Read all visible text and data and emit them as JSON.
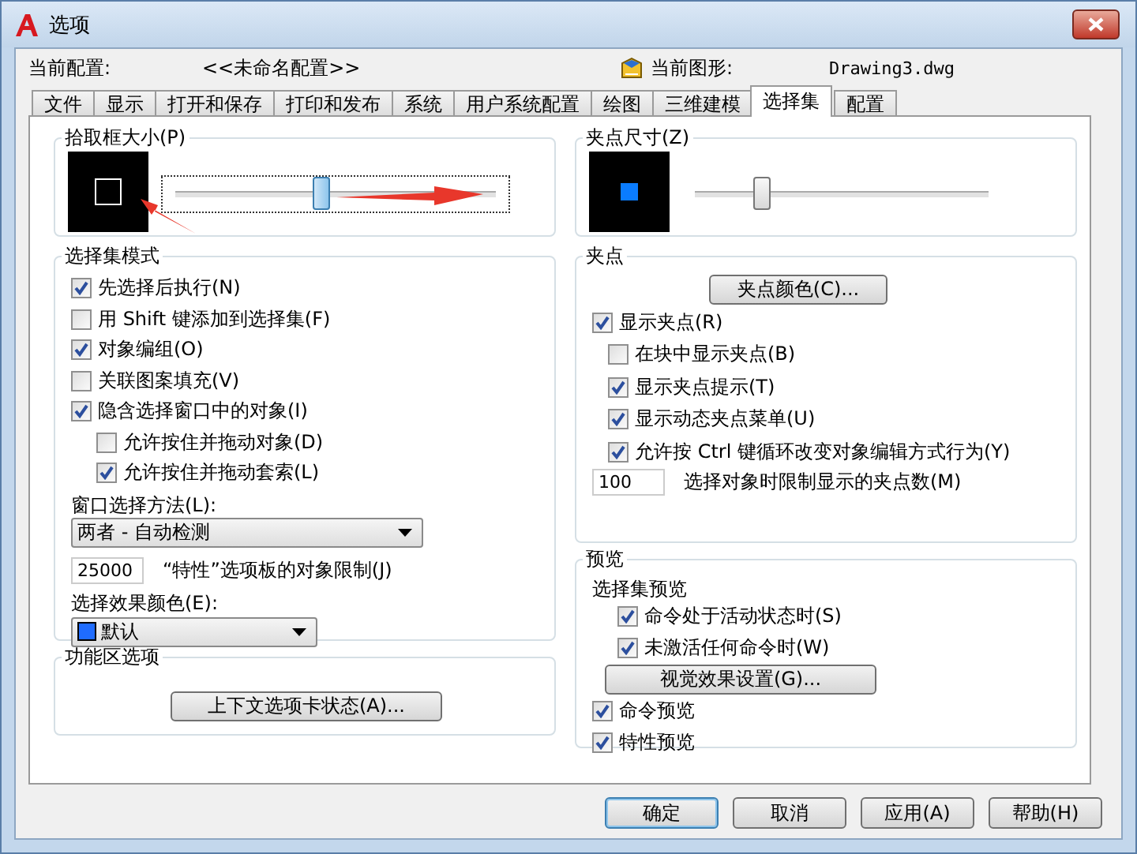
{
  "window": {
    "title": "选项"
  },
  "header": {
    "profile_label": "当前配置:",
    "profile_value": "<<未命名配置>>",
    "drawing_label": "当前图形:",
    "drawing_value": "Drawing3.dwg"
  },
  "tabs": [
    {
      "label": "文件",
      "selected": false
    },
    {
      "label": "显示",
      "selected": false
    },
    {
      "label": "打开和保存",
      "selected": false
    },
    {
      "label": "打印和发布",
      "selected": false
    },
    {
      "label": "系统",
      "selected": false
    },
    {
      "label": "用户系统配置",
      "selected": false
    },
    {
      "label": "绘图",
      "selected": false
    },
    {
      "label": "三维建模",
      "selected": false
    },
    {
      "label": "选择集",
      "selected": true
    },
    {
      "label": "配置",
      "selected": false
    }
  ],
  "pickbox": {
    "title": "拾取框大小(P)",
    "level": 0.45
  },
  "selection_modes": {
    "title": "选择集模式",
    "options": [
      {
        "label": "先选择后执行(N)",
        "checked": true
      },
      {
        "label": "用 Shift 键添加到选择集(F)",
        "checked": false
      },
      {
        "label": "对象编组(O)",
        "checked": true
      },
      {
        "label": "关联图案填充(V)",
        "checked": false
      },
      {
        "label": "隐含选择窗口中的对象(I)",
        "checked": true,
        "children": [
          {
            "label": "允许按住并拖动对象(D)",
            "checked": false
          },
          {
            "label": "允许按住并拖动套索(L)",
            "checked": true
          }
        ]
      }
    ],
    "window_method": {
      "label": "窗口选择方法(L):",
      "value": "两者 - 自动检测"
    },
    "object_limit": {
      "value": "25000",
      "label": "“特性”选项板的对象限制(J)"
    },
    "effect_color": {
      "label": "选择效果颜色(E):",
      "value": "默认"
    }
  },
  "ribbon": {
    "title": "功能区选项",
    "button": "上下文选项卡状态(A)..."
  },
  "grip_size": {
    "title": "夹点尺寸(Z)",
    "level": 0.22
  },
  "grips": {
    "title": "夹点",
    "color_button": "夹点颜色(C)...",
    "options": [
      {
        "label": "显示夹点(R)",
        "checked": true,
        "children": [
          {
            "label": "在块中显示夹点(B)",
            "checked": false
          },
          {
            "label": "显示夹点提示(T)",
            "checked": true
          },
          {
            "label": "显示动态夹点菜单(U)",
            "checked": true
          },
          {
            "label": "允许按 Ctrl 键循环改变对象编辑方式行为(Y)",
            "checked": true
          }
        ]
      }
    ],
    "limit_value": "100",
    "limit_label": "选择对象时限制显示的夹点数(M)"
  },
  "preview": {
    "title": "预览",
    "selection_preview": {
      "label": "选择集预览",
      "options": [
        {
          "label": "命令处于活动状态时(S)",
          "checked": true
        },
        {
          "label": "未激活任何命令时(W)",
          "checked": true
        }
      ]
    },
    "visual_button": "视觉效果设置(G)...",
    "options": [
      {
        "label": "命令预览",
        "checked": true
      },
      {
        "label": "特性预览",
        "checked": true
      }
    ]
  },
  "buttons": [
    {
      "label": "确定",
      "default": true
    },
    {
      "label": "取消",
      "default": false
    },
    {
      "label": "应用(A)",
      "default": false
    },
    {
      "label": "帮助(H)",
      "default": false
    }
  ]
}
